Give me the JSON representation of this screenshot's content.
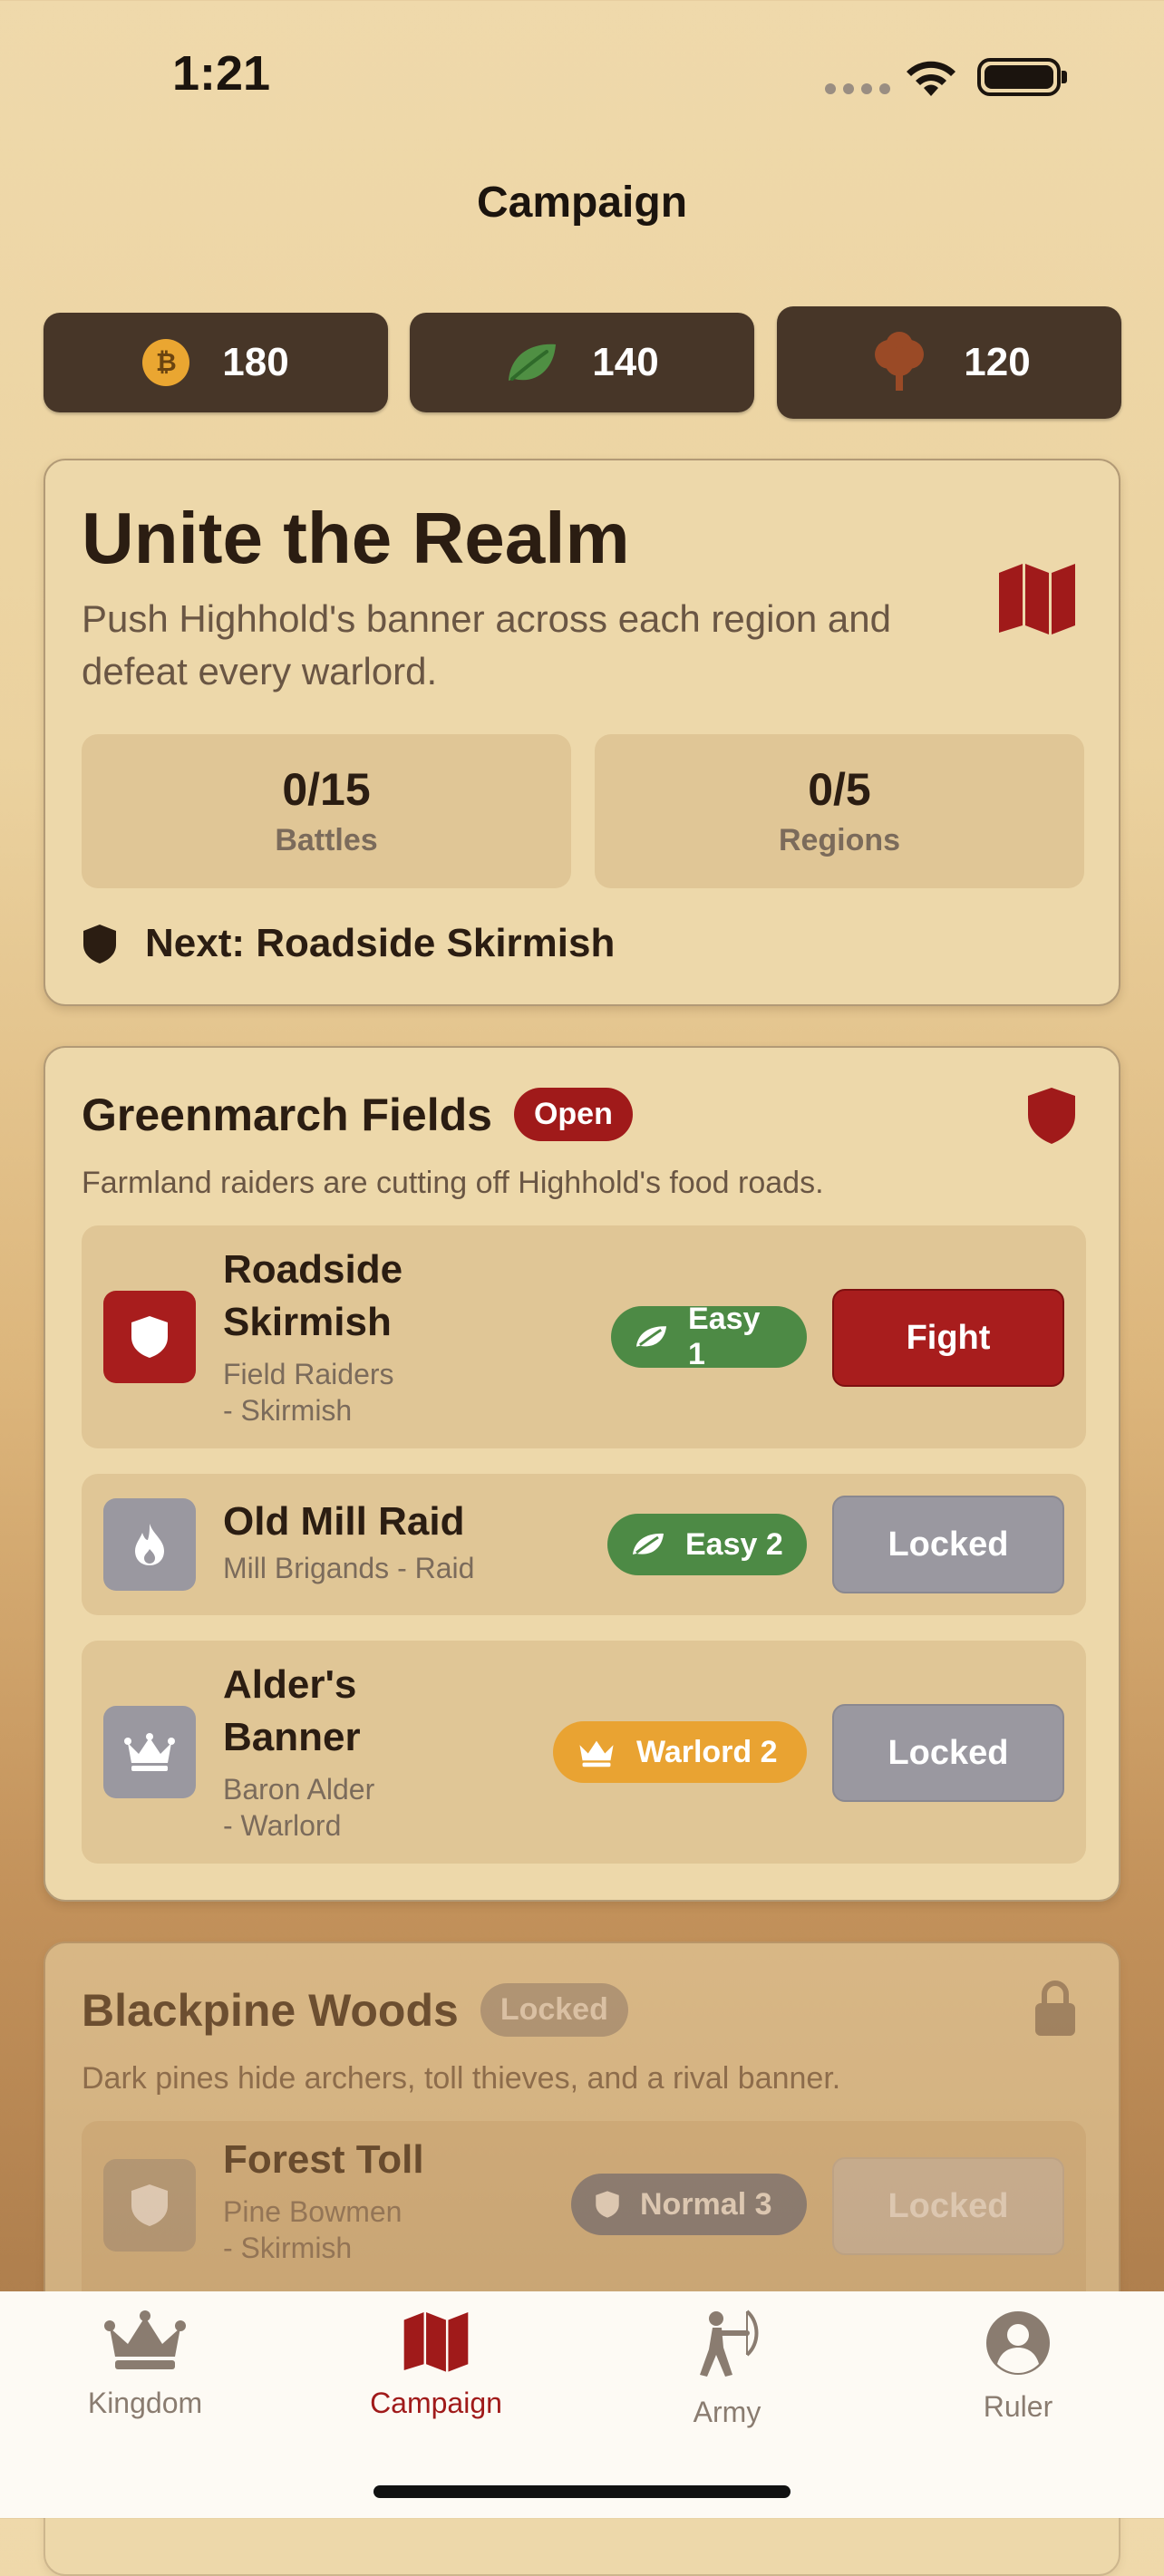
{
  "status": {
    "time": "1:21"
  },
  "nav": {
    "title": "Campaign"
  },
  "resources": [
    {
      "icon": "gold-coin-icon",
      "value": "180"
    },
    {
      "icon": "leaf-icon",
      "value": "140"
    },
    {
      "icon": "tree-icon",
      "value": "120"
    }
  ],
  "campaign": {
    "title": "Unite the Realm",
    "description": "Push Highhold's banner across each region and defeat every warlord.",
    "battles_value": "0/15",
    "battles_label": "Battles",
    "regions_value": "0/5",
    "regions_label": "Regions",
    "next": "Next: Roadside Skirmish"
  },
  "regions": [
    {
      "name": "Greenmarch Fields",
      "status": "Open",
      "description": "Farmland raiders are cutting off Highhold's food roads.",
      "battles": [
        {
          "name_line1": "Roadside",
          "name_line2": "Skirmish",
          "sub_line1": "Field Raiders",
          "sub_line2": "- Skirmish",
          "difficulty": "Easy 1",
          "action": "Fight"
        },
        {
          "name": "Old Mill Raid",
          "sub": "Mill Brigands - Raid",
          "difficulty": "Easy 2",
          "action": "Locked"
        },
        {
          "name_line1": "Alder's",
          "name_line2": "Banner",
          "sub_line1": "Baron Alder",
          "sub_line2": "- Warlord",
          "difficulty": "Warlord 2",
          "action": "Locked"
        }
      ]
    },
    {
      "name": "Blackpine Woods",
      "status": "Locked",
      "description": "Dark pines hide archers, toll thieves, and a rival banner.",
      "battles": [
        {
          "name": "Forest Toll",
          "sub_line1": "Pine Bowmen",
          "sub_line2": "- Skirmish",
          "difficulty": "Normal 3",
          "action": "Locked"
        }
      ]
    }
  ],
  "tabs": [
    {
      "label": "Kingdom",
      "icon": "crown-icon"
    },
    {
      "label": "Campaign",
      "icon": "map-icon",
      "active": true
    },
    {
      "label": "Army",
      "icon": "archer-icon"
    },
    {
      "label": "Ruler",
      "icon": "person-icon"
    }
  ],
  "colors": {
    "accent": "#a01a1a",
    "resource_bg": "#473628",
    "card_bg": "#edd8aa"
  }
}
